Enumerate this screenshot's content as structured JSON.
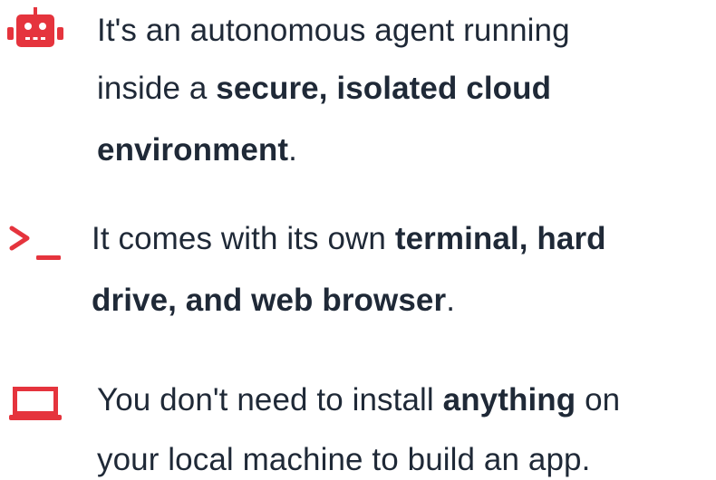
{
  "accent_color": "#e5343d",
  "text_color": "#1f2937",
  "features": [
    {
      "icon": "robot-icon",
      "lines": [
        {
          "pre": "It's an autonomous agent running",
          "bold": "",
          "post": ""
        },
        {
          "pre": "inside a ",
          "bold": "secure, isolated cloud",
          "post": ""
        },
        {
          "pre": "",
          "bold": "environment",
          "post": "."
        }
      ]
    },
    {
      "icon": "terminal-icon",
      "lines": [
        {
          "pre": "It comes with its own ",
          "bold": "terminal, hard",
          "post": ""
        },
        {
          "pre": "",
          "bold": "drive, and web browser",
          "post": "."
        }
      ]
    },
    {
      "icon": "laptop-icon",
      "lines": [
        {
          "pre": "You don't need to install ",
          "bold": "anything",
          "post": " on"
        },
        {
          "pre": "your local machine to build an app.",
          "bold": "",
          "post": ""
        }
      ]
    }
  ]
}
